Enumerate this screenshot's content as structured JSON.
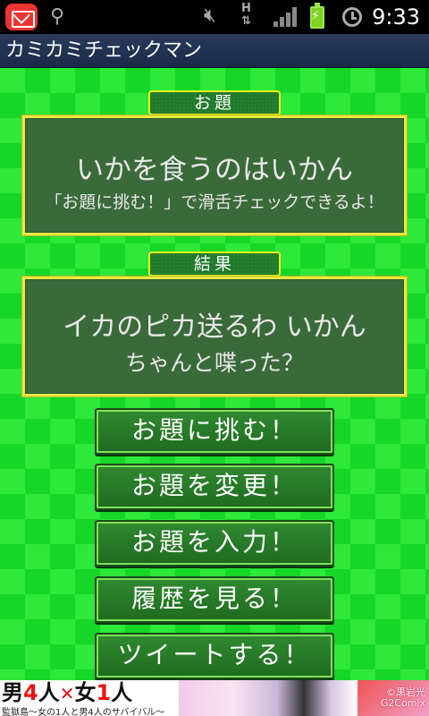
{
  "status_bar": {
    "time": "9:33",
    "network_type": "H",
    "icons": [
      "mail-icon",
      "usb-icon",
      "mute-icon",
      "signal-icon",
      "battery-charging-icon",
      "alarm-icon"
    ]
  },
  "app": {
    "title": "カミカミチェックマン"
  },
  "topic": {
    "tag": "お題",
    "phrase": "いかを食うのはいかん",
    "hint": "「お題に挑む！」で滑舌チェックできるよ！"
  },
  "result": {
    "tag": "結果",
    "phrase": "イカのピカ送るわ いかん",
    "question": "ちゃんと喋った？"
  },
  "buttons": {
    "challenge": "お題に挑む！",
    "change": "お題を変更！",
    "input": "お題を入力！",
    "history": "履歴を見る！",
    "tweet": "ツイートする！"
  },
  "ad": {
    "headline_parts": [
      "男",
      "4",
      "人",
      "✕",
      "女",
      "1",
      "人"
    ],
    "subline": "監獄島〜女の1人と男4人のサバイバル〜",
    "credit_line1": "©黒岩光",
    "credit_line2": "G2Comix"
  },
  "colors": {
    "background_light": "#2ee83a",
    "background_dark": "#16d628",
    "board_fill": "#3a6a3a",
    "board_border": "#e9e940",
    "button_fill": "#2f8a2f"
  }
}
